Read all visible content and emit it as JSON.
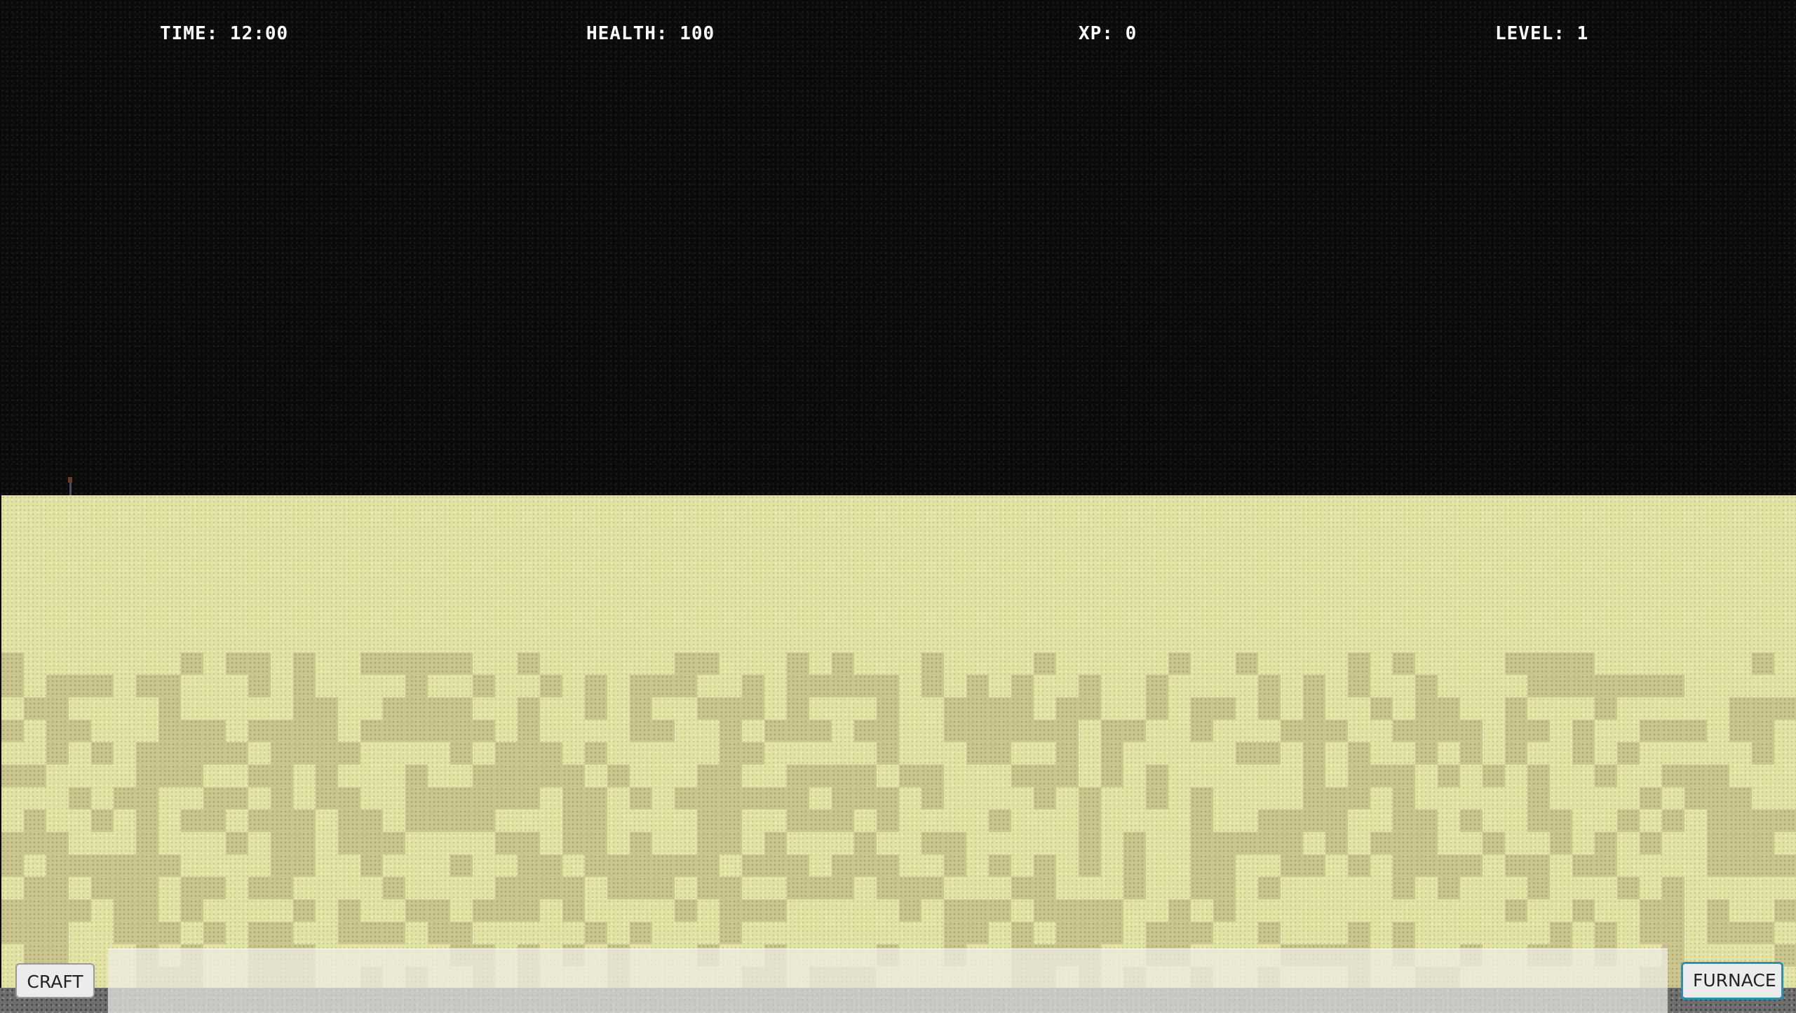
{
  "hud": {
    "time": "TIME: 12:00",
    "health": "HEALTH: 100",
    "xp": "XP: 0",
    "level": "LEVEL: 1"
  },
  "controls": {
    "craft_label": "CRAFT",
    "furnace_label": "FURNACE"
  },
  "colors": {
    "sky": "#0a0a0b",
    "sand_light": "#e2e3a5",
    "sand_dark": "#cbc58f",
    "bedrock": "#6e6e6e",
    "furnace_outline": "#2f8fb0"
  }
}
